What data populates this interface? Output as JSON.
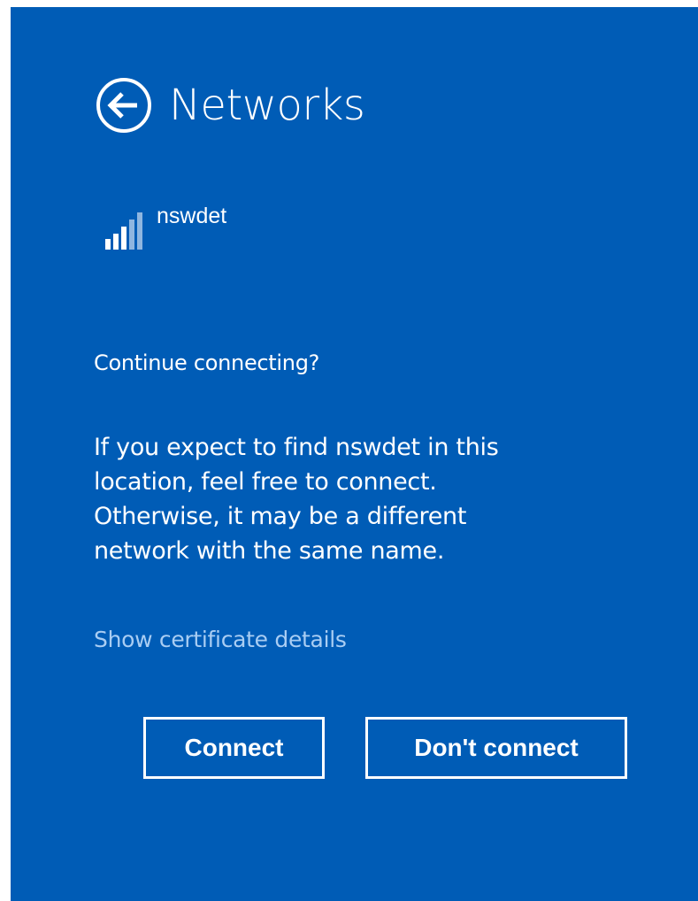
{
  "header": {
    "title": "Networks",
    "back_icon": "back-arrow-circle-icon"
  },
  "network": {
    "name": "nswdet",
    "signal_icon": "wifi-signal-icon",
    "signal_bars_filled": 3,
    "signal_bars_total": 5
  },
  "dialog": {
    "prompt": "Continue connecting?",
    "message_lines": [
      "If you expect to find nswdet in this",
      "location, feel free to connect.",
      "Otherwise, it may be a different",
      "network with the same name."
    ],
    "cert_link": "Show certificate details"
  },
  "buttons": {
    "connect_label": "Connect",
    "dont_connect_label": "Don't connect"
  },
  "colors": {
    "background": "#005cb6",
    "text": "#ffffff",
    "link": "#a9cdf3",
    "signal_dim": "#8fb6e0"
  }
}
